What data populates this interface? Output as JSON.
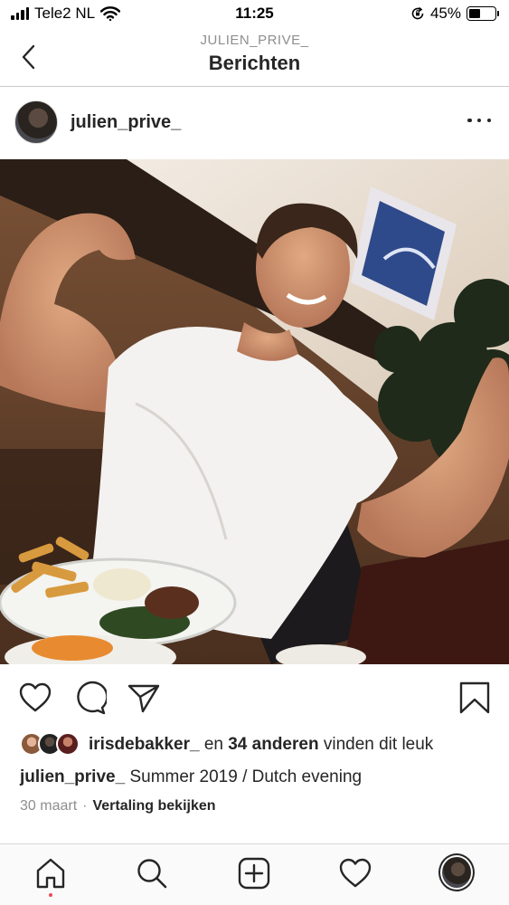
{
  "status_bar": {
    "carrier": "Tele2 NL",
    "time": "11:25",
    "battery": "45%",
    "battery_level": 0.45
  },
  "header": {
    "subtitle": "JULIEN_PRIVE_",
    "title": "Berichten"
  },
  "post": {
    "username": "julien_prive_",
    "likes": {
      "first_liker": "irisdebakker_",
      "connector": "en",
      "others": "34 anderen",
      "suffix": "vinden dit leuk"
    },
    "caption": {
      "username": "julien_prive_",
      "text": "Summer 2019 / Dutch evening"
    },
    "date": "30 maart",
    "separator": "·",
    "translate": "Vertaling bekijken"
  },
  "colors": {
    "text": "#262626",
    "muted": "#8e8e8e",
    "notification_dot": "#ed4956"
  },
  "icons": {
    "actions": [
      "heart-icon",
      "comment-icon",
      "share-icon",
      "bookmark-icon"
    ],
    "tabs": [
      "home-icon",
      "search-icon",
      "add-post-icon",
      "activity-heart-icon",
      "profile-avatar"
    ]
  }
}
